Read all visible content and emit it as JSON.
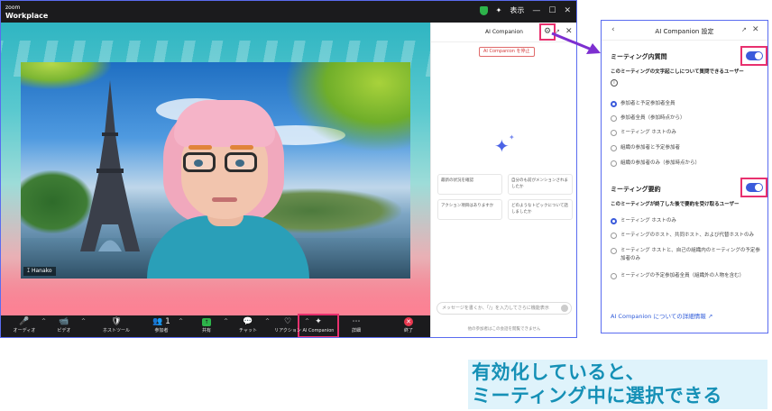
{
  "titlebar": {
    "brand_small": "zoom",
    "brand_main": "Workplace",
    "view_label": "表示",
    "minimize": "—",
    "maximize": "☐",
    "close": "✕"
  },
  "video": {
    "participant_name": "Hanako"
  },
  "controls": [
    {
      "name": "audio",
      "label": "オーディオ",
      "icon": "🎤",
      "caret": true,
      "red": true
    },
    {
      "name": "video",
      "label": "ビデオ",
      "icon": "📹",
      "caret": true,
      "red": true
    },
    {
      "name": "host-tools",
      "label": "ホストツール",
      "icon": "🛡",
      "caret": false,
      "red": false
    },
    {
      "name": "participants",
      "label": "参加者",
      "icon": "👥 1",
      "caret": true,
      "red": false
    },
    {
      "name": "share",
      "label": "共有",
      "icon": "share",
      "caret": true,
      "red": false
    },
    {
      "name": "chat",
      "label": "チャット",
      "icon": "💬",
      "caret": true,
      "red": false
    },
    {
      "name": "reactions",
      "label": "リアクション",
      "icon": "♡",
      "caret": true,
      "red": false
    },
    {
      "name": "ai-companion",
      "label": "AI Companion",
      "icon": "✦",
      "caret": false,
      "red": false
    },
    {
      "name": "more",
      "label": "詳細",
      "icon": "⋯",
      "caret": false,
      "red": false
    },
    {
      "name": "end",
      "label": "終了",
      "icon": "end",
      "caret": false,
      "red": false
    }
  ],
  "ai_panel": {
    "title": "AI Companion",
    "stop_button": "AI Companion を停止",
    "suggestions": [
      "最新の状況を確認",
      "自分のも前がメンションされましたか",
      "アクション項目はありますか",
      "どのようなトピックについて話しましたか"
    ],
    "input_placeholder": "メッセージを書くか、「/」を入力してさらに機能表示",
    "footer": "他の参加者はこの会話を閲覧できません"
  },
  "settings": {
    "title": "AI Companion 設定",
    "section1": {
      "title": "ミーティング内質問",
      "subtitle": "このミーティングの文字起こしについて質問できるユーザー",
      "info": "i",
      "options": [
        {
          "label": "参加者と予定参加者全員",
          "selected": true
        },
        {
          "label": "参加者全員（参加時点から）",
          "selected": false
        },
        {
          "label": "ミーティング ホストのみ",
          "selected": false
        },
        {
          "label": "組織の参加者と予定参加者",
          "selected": false
        },
        {
          "label": "組織の参加者のみ（参加時点から）",
          "selected": false
        }
      ]
    },
    "section2": {
      "title": "ミーティング要約",
      "subtitle": "このミーティングが終了した後で要約を受け取るユーザー",
      "options": [
        {
          "label": "ミーティング ホストのみ",
          "selected": true
        },
        {
          "label": "ミーティングのホスト、共同ホスト、および代替ホストのみ",
          "selected": false
        },
        {
          "label": "ミーティング ホストと、自己の組織内のミーティングの予定参加者のみ",
          "selected": false
        },
        {
          "label": "ミーティングの予定参加者全員（組織外の人物を含む）",
          "selected": false
        }
      ]
    },
    "link": "AI Companion についての詳細情報 ↗"
  },
  "caption": {
    "line1": "有効化していると、",
    "line2": "ミーティング中に選択できる"
  },
  "colors": {
    "accent": "#3b5bdb",
    "highlight": "#e8306e",
    "caption_text": "#1590b6",
    "caption_bg": "#dff3fb"
  }
}
